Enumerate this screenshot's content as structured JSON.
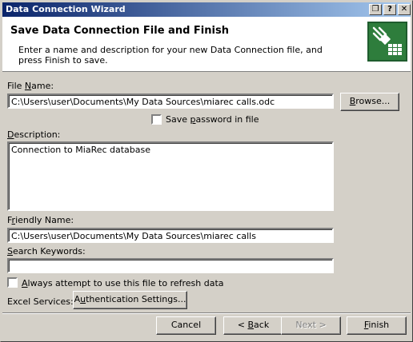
{
  "window": {
    "title": "Data Connection Wizard",
    "controls": {
      "restore": "❐",
      "help": "?",
      "close": "✕"
    }
  },
  "header": {
    "title": "Save Data Connection File and Finish",
    "description": "Enter a name and description for your new Data Connection file, and press Finish to save.",
    "icon": "data-connection-icon"
  },
  "form": {
    "file_name": {
      "label_pre": "File ",
      "label_accel": "N",
      "label_post": "ame:",
      "value": "C:\\Users\\user\\Documents\\My Data Sources\\miarec calls.odc"
    },
    "browse": {
      "pre": "",
      "accel": "B",
      "post": "rowse..."
    },
    "save_password": {
      "pre": "Save ",
      "accel": "p",
      "post": "assword in file",
      "checked": false
    },
    "description": {
      "label_pre": "",
      "label_accel": "D",
      "label_post": "escription:",
      "value": "Connection to MiaRec database"
    },
    "friendly_name": {
      "label_pre": "F",
      "label_accel": "r",
      "label_post": "iendly Name:",
      "value": "C:\\Users\\user\\Documents\\My Data Sources\\miarec calls"
    },
    "search_keywords": {
      "label_pre": "",
      "label_accel": "S",
      "label_post": "earch Keywords:",
      "value": ""
    },
    "always_refresh": {
      "pre": "",
      "accel": "A",
      "post": "lways attempt to use this file to refresh data",
      "checked": false
    },
    "excel_services": {
      "label": "Excel Services:",
      "auth_pre": "A",
      "auth_accel": "u",
      "auth_post": "thentication Settings..."
    }
  },
  "footer": {
    "cancel": "Cancel",
    "back": {
      "pre": "< ",
      "accel": "B",
      "post": "ack"
    },
    "next": "Next >",
    "finish": {
      "pre": "",
      "accel": "F",
      "post": "inish"
    }
  }
}
